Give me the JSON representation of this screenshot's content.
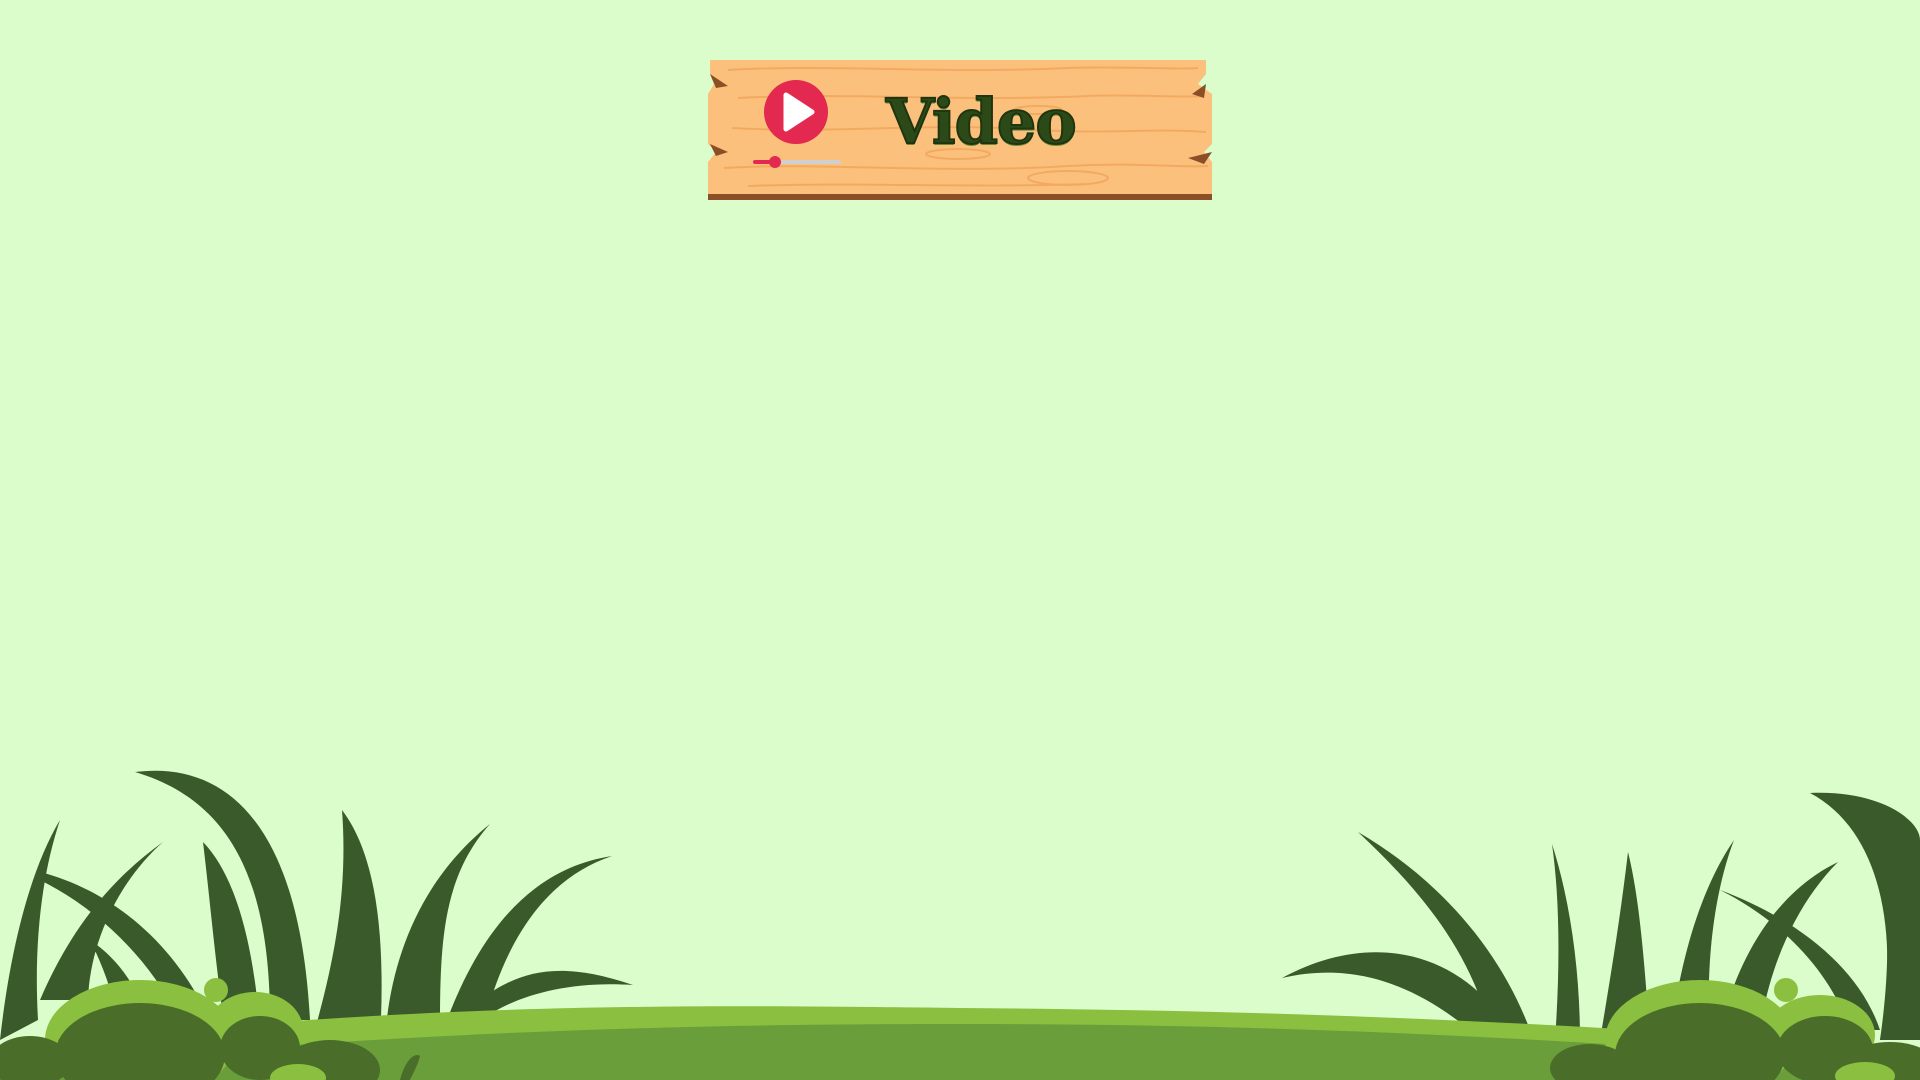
{
  "sign": {
    "title": "Video",
    "play_icon": "play-icon",
    "volume_level": 0.25
  },
  "colors": {
    "background": "#dbfccb",
    "wood": "#fcc07d",
    "wood_grain": "#f0a55a",
    "wood_edge": "#8a4f26",
    "accent": "#e3294f",
    "title_text": "#2c4a17",
    "grass_dark": "#3a5a2c",
    "grass_light": "#8bbf3f",
    "bush": "#4a6e2a"
  }
}
